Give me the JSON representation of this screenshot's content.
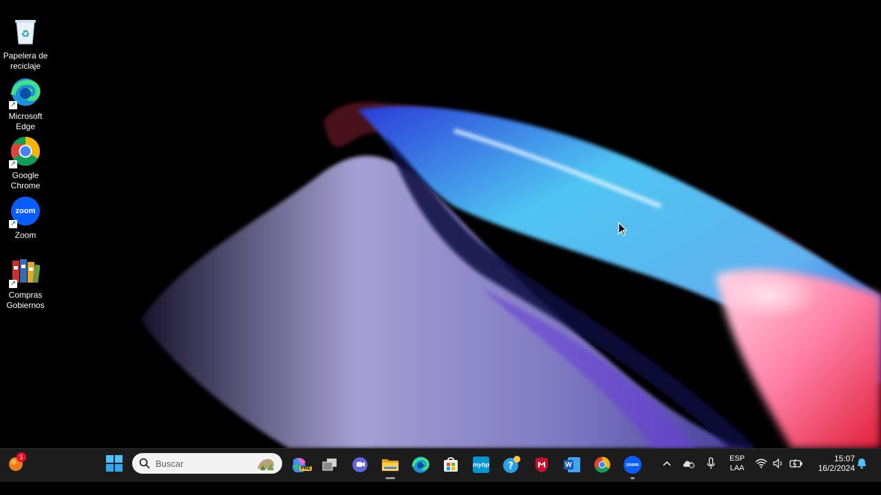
{
  "desktop": {
    "icons": [
      {
        "label": "Papelera de reciclaje",
        "icon": "recycle-bin-icon"
      },
      {
        "label": "Microsoft Edge",
        "icon": "edge-icon"
      },
      {
        "label": "Google Chrome",
        "icon": "chrome-icon"
      },
      {
        "label": "Zoom",
        "icon": "zoom-icon",
        "glyph": "zoom"
      },
      {
        "label": "Compras Gobiernos",
        "icon": "binders-icon"
      }
    ]
  },
  "taskbar": {
    "widgets_badge": "1",
    "search": {
      "placeholder": "Buscar"
    },
    "apps": [
      {
        "name": "copilot",
        "icon": "copilot-icon",
        "tag": "PRE"
      },
      {
        "name": "task-view",
        "icon": "task-view-icon"
      },
      {
        "name": "teams-chat",
        "icon": "chat-icon"
      },
      {
        "name": "file-explorer",
        "icon": "folder-icon",
        "running": true
      },
      {
        "name": "edge",
        "icon": "edge-icon"
      },
      {
        "name": "store",
        "icon": "store-icon"
      },
      {
        "name": "myhp",
        "icon": "myhp-icon",
        "text": "myhp"
      },
      {
        "name": "get-help",
        "icon": "help-icon"
      },
      {
        "name": "mcafee",
        "icon": "mcafee-icon"
      },
      {
        "name": "word",
        "icon": "word-icon",
        "text": "W"
      },
      {
        "name": "chrome",
        "icon": "chrome-icon"
      },
      {
        "name": "zoom",
        "icon": "zoom-icon",
        "text": "zoom",
        "running": true
      }
    ],
    "tray": {
      "language": "ESP",
      "layout": "LAA",
      "time": "15:07",
      "date": "16/2/2024"
    }
  },
  "colors": {
    "taskbar_bg": "#1c1c1c",
    "accent_blue": "#0078d4",
    "zoom_blue": "#0b5cff"
  }
}
